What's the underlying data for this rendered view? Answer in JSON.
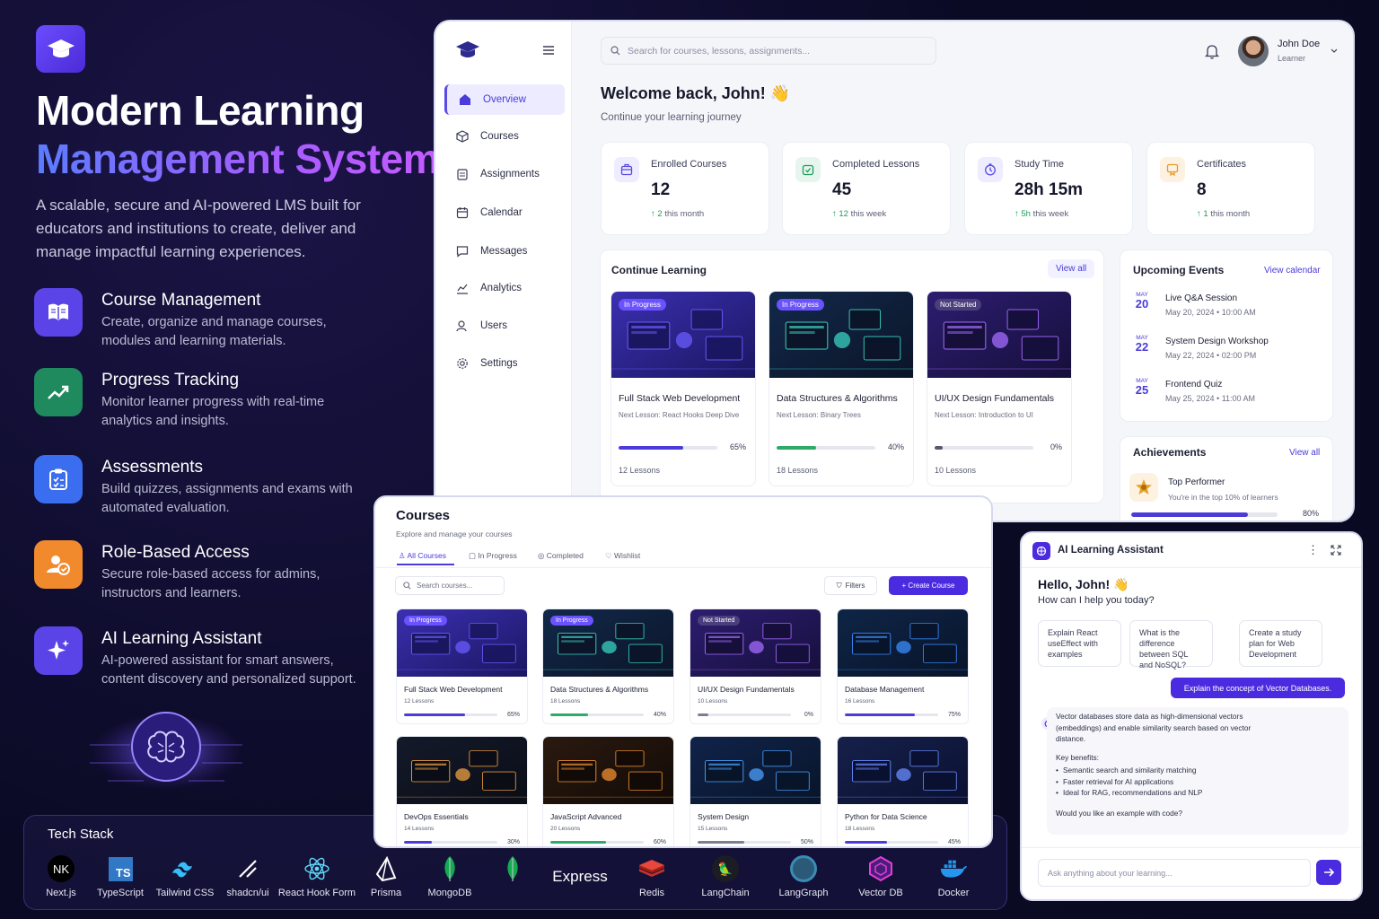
{
  "hero": {
    "title_line1": "Modern Learning",
    "title_line2": "Management System",
    "description": "A scalable, secure and AI-powered LMS built for educators and institutions to create, deliver and manage impactful learning experiences."
  },
  "features": [
    {
      "title": "Course Management",
      "desc": "Create, organize and manage courses, modules and learning materials.",
      "icon": "book-icon",
      "color": "#5a44e8"
    },
    {
      "title": "Progress Tracking",
      "desc": "Monitor learner progress with real-time analytics and insights.",
      "icon": "trend-icon",
      "color": "#1f8a5e"
    },
    {
      "title": "Assessments",
      "desc": "Build quizzes, assignments and exams with automated evaluation.",
      "icon": "clipboard-icon",
      "color": "#3a6df0"
    },
    {
      "title": "Role-Based Access",
      "desc": "Secure role-based access for admins, instructors and learners.",
      "icon": "users-icon",
      "color": "#f08a2c"
    },
    {
      "title": "AI Learning Assistant",
      "desc": "AI-powered assistant for smart answers, content discovery and personalized support.",
      "icon": "sparkles-icon",
      "color": "#5a44e8"
    }
  ],
  "tech_stack": {
    "title": "Tech Stack",
    "items": [
      "Next.js",
      "TypeScript",
      "Tailwind CSS",
      "shadcn/ui",
      "React Hook Form",
      "Prisma",
      "MongoDB",
      "Express",
      "Redis",
      "LangChain",
      "LangGraph",
      "Vector DB",
      "Docker"
    ],
    "express_wordmark": "Express",
    "next_mark": "NK",
    "ts_mark": "TS"
  },
  "dashboard": {
    "nav": [
      "Overview",
      "Courses",
      "Assignments",
      "Calendar",
      "Messages",
      "Analytics",
      "Users",
      "Settings"
    ],
    "search_placeholder": "Search for courses, lessons, assignments...",
    "user": {
      "name": "John Doe",
      "role": "Learner"
    },
    "welcome": "Welcome back, John! 👋",
    "welcome_sub": "Continue your learning journey",
    "stats": [
      {
        "label": "Enrolled Courses",
        "value": "12",
        "delta": "↑ 2",
        "delta_rest": " this month",
        "color": "#5a49e6",
        "bg": "#eeecff",
        "icon": "briefcase-icon"
      },
      {
        "label": "Completed Lessons",
        "value": "45",
        "delta": "↑ 12",
        "delta_rest": " this week",
        "color": "#1d9a5b",
        "bg": "#e6f6ee",
        "icon": "check-icon"
      },
      {
        "label": "Study Time",
        "value": "28h 15m",
        "delta": "↑ 5h",
        "delta_rest": " this week",
        "color": "#5a49e6",
        "bg": "#eeecff",
        "icon": "clock-icon"
      },
      {
        "label": "Certificates",
        "value": "8",
        "delta": "↑ 1",
        "delta_rest": " this month",
        "color": "#e59a2c",
        "bg": "#fdf2e2",
        "icon": "certificate-icon"
      }
    ],
    "continue": {
      "title": "Continue Learning",
      "view_all": "View all",
      "courses": [
        {
          "status": "In Progress",
          "name": "Full Stack Web Development",
          "next": "Next Lesson: React Hooks Deep Dive",
          "progress": 65,
          "progress_label": "65%",
          "lessons": "12 Lessons",
          "color": "#4b3bd8"
        },
        {
          "status": "In Progress",
          "name": "Data Structures & Algorithms",
          "next": "Next Lesson: Binary Trees",
          "progress": 40,
          "progress_label": "40%",
          "lessons": "18 Lessons",
          "color": "#2eaa6b"
        },
        {
          "status": "Not Started",
          "name": "UI/UX Design Fundamentals",
          "next": "Next Lesson: Introduction to UI",
          "progress": 0,
          "progress_label": "0%",
          "lessons": "10 Lessons",
          "color": "#555a70"
        }
      ]
    },
    "events": {
      "title": "Upcoming Events",
      "link": "View calendar",
      "items": [
        {
          "month": "MAY",
          "day": "20",
          "title": "Live Q&A Session",
          "when": "May 20, 2024 • 10:00 AM"
        },
        {
          "month": "MAY",
          "day": "22",
          "title": "System Design Workshop",
          "when": "May 22, 2024 • 02:00 PM"
        },
        {
          "month": "MAY",
          "day": "25",
          "title": "Frontend Quiz",
          "when": "May 25, 2024 • 11:00 AM"
        }
      ]
    },
    "achievements": {
      "title": "Achievements",
      "link": "View all",
      "name": "Top Performer",
      "desc": "You're in the top 10% of learners",
      "progress": 80,
      "progress_label": "80%"
    }
  },
  "courses_panel": {
    "title": "Courses",
    "subtitle": "Explore and manage your courses",
    "tabs": [
      "All Courses",
      "In Progress",
      "Completed",
      "Wishlist"
    ],
    "search_placeholder": "Search courses...",
    "filters": "Filters",
    "create": "+ Create Course",
    "cards": [
      {
        "status": "In Progress",
        "name": "Full Stack Web Development",
        "lessons": "12 Lessons",
        "progress": 65,
        "progress_label": "65%",
        "color": "#4b3bd8"
      },
      {
        "status": "In Progress",
        "name": "Data Structures & Algorithms",
        "lessons": "18 Lessons",
        "progress": 40,
        "progress_label": "40%",
        "color": "#2eaa6b"
      },
      {
        "status": "Not Started",
        "name": "UI/UX Design Fundamentals",
        "lessons": "10 Lessons",
        "progress": 0,
        "progress_label": "0%",
        "color": "#7b7f95"
      },
      {
        "status": "",
        "name": "Database Management",
        "lessons": "16 Lessons",
        "progress": 75,
        "progress_label": "75%",
        "color": "#4b3bd8"
      },
      {
        "status": "",
        "name": "DevOps Essentials",
        "lessons": "14 Lessons",
        "progress": 30,
        "progress_label": "30%",
        "color": "#4b3bd8"
      },
      {
        "status": "",
        "name": "JavaScript Advanced",
        "lessons": "20 Lessons",
        "progress": 60,
        "progress_label": "60%",
        "color": "#2eaa6b"
      },
      {
        "status": "",
        "name": "System Design",
        "lessons": "15 Lessons",
        "progress": 50,
        "progress_label": "50%",
        "color": "#7b7f95"
      },
      {
        "status": "",
        "name": "Python for Data Science",
        "lessons": "18 Lessons",
        "progress": 45,
        "progress_label": "45%",
        "color": "#4b3bd8"
      }
    ]
  },
  "assistant": {
    "title": "AI Learning Assistant",
    "greeting": "Hello, John! 👋",
    "prompt": "How can I help you today?",
    "suggestions": [
      "Explain React useEffect with examples",
      "What is the difference between SQL and NoSQL?",
      "Create a study plan for Web Development"
    ],
    "user_message": "Explain the concept of Vector Databases.",
    "answer_intro": "Vector databases store data as high-dimensional vectors (embeddings) and enable similarity search based on vector distance.",
    "answer_heading": "Key benefits:",
    "answer_points": [
      "Semantic search and similarity matching",
      "Faster retrieval for AI applications",
      "Ideal for RAG, recommendations and NLP"
    ],
    "answer_outro": "Would you like an example with code?",
    "input_placeholder": "Ask anything about your learning..."
  }
}
